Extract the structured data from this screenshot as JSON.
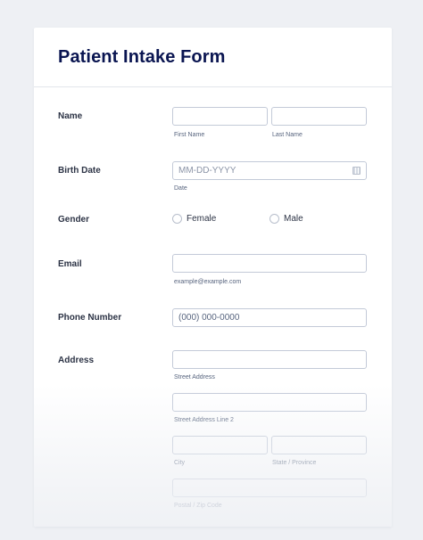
{
  "form": {
    "title": "Patient Intake Form"
  },
  "fields": {
    "name": {
      "label": "Name",
      "first_sublabel": "First Name",
      "last_sublabel": "Last Name"
    },
    "birth_date": {
      "label": "Birth Date",
      "placeholder": "MM-DD-YYYY",
      "sublabel": "Date"
    },
    "gender": {
      "label": "Gender",
      "options": [
        "Female",
        "Male"
      ]
    },
    "email": {
      "label": "Email",
      "sublabel": "example@example.com"
    },
    "phone": {
      "label": "Phone Number",
      "placeholder": "(000) 000-0000"
    },
    "address": {
      "label": "Address",
      "street_sublabel": "Street Address",
      "street2_sublabel": "Street Address Line 2",
      "city_sublabel": "City",
      "state_sublabel": "State / Province",
      "postal_sublabel": "Postal / Zip Code"
    }
  },
  "icons": {
    "calendar": "calendar-icon",
    "radio": "radio-unchecked-icon"
  },
  "colors": {
    "title": "#0a1551",
    "background": "#eef0f4",
    "input_border": "#c3cad8",
    "sublabel": "#57647e"
  }
}
